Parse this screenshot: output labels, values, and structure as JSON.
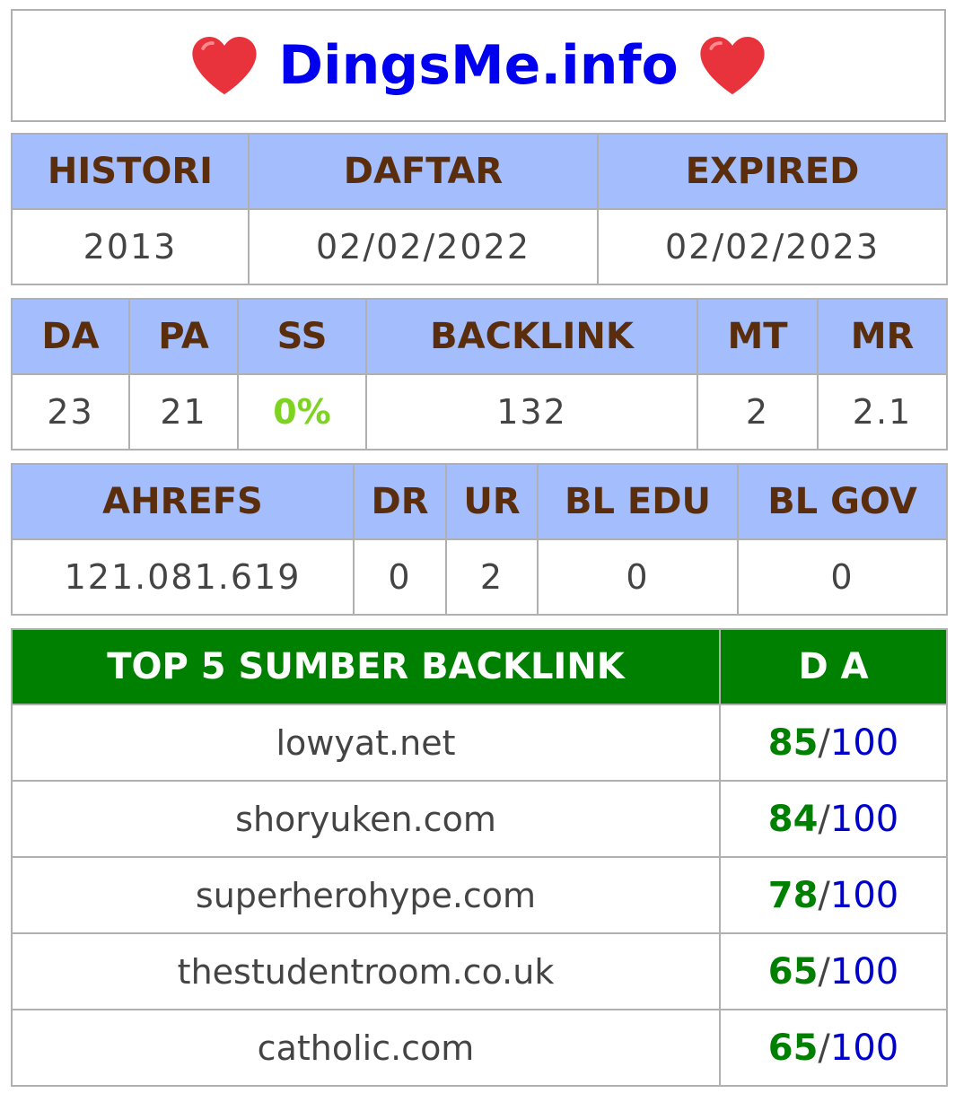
{
  "title": "DingsMe.info",
  "icons": {
    "left": "heart-icon",
    "right": "heart-icon",
    "heart_color": "#e8323c"
  },
  "colors": {
    "header_bg": "#a4bdfc",
    "header_text": "#5a2e0c",
    "title": "#0000ee",
    "green_header_bg": "#008000",
    "ss_value": "#7ed321",
    "da_value": "#008000",
    "da_max": "#0000cc"
  },
  "dates": {
    "headers": [
      "HISTORI",
      "DAFTAR",
      "EXPIRED"
    ],
    "values": [
      "2013",
      "02/02/2022",
      "02/02/2023"
    ]
  },
  "metrics": {
    "headers": [
      "DA",
      "PA",
      "SS",
      "BACKLINK",
      "MT",
      "MR"
    ],
    "values": [
      "23",
      "21",
      "0%",
      "132",
      "2",
      "2.1"
    ]
  },
  "ahrefs": {
    "headers": [
      "AHREFS",
      "DR",
      "UR",
      "BL EDU",
      "BL GOV"
    ],
    "values": [
      "121.081.619",
      "0",
      "2",
      "0",
      "0"
    ]
  },
  "top_backlinks": {
    "headers": [
      "TOP 5 SUMBER BACKLINK",
      "D A"
    ],
    "separator": "/",
    "rows": [
      {
        "site": "lowyat.net",
        "da": "85",
        "max": "100"
      },
      {
        "site": "shoryuken.com",
        "da": "84",
        "max": "100"
      },
      {
        "site": "superherohype.com",
        "da": "78",
        "max": "100"
      },
      {
        "site": "thestudentroom.co.uk",
        "da": "65",
        "max": "100"
      },
      {
        "site": "catholic.com",
        "da": "65",
        "max": "100"
      }
    ]
  }
}
